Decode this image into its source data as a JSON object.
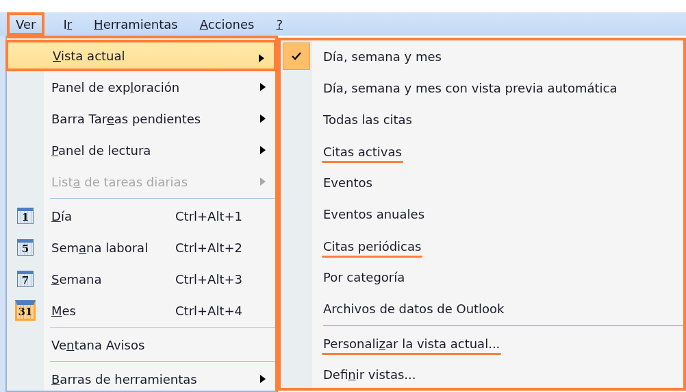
{
  "menubar": [
    {
      "parts": [
        {
          "text": "Ver",
          "underlined": false
        }
      ],
      "highlighted": true
    },
    {
      "parts": [
        {
          "text": "I",
          "underlined": false
        },
        {
          "text": "r",
          "underlined": true
        }
      ],
      "highlighted": false
    },
    {
      "parts": [
        {
          "text": "H",
          "underlined": true
        },
        {
          "text": "erramientas",
          "underlined": false
        }
      ],
      "highlighted": false
    },
    {
      "parts": [
        {
          "text": "A",
          "underlined": true
        },
        {
          "text": "cciones",
          "underlined": false
        }
      ],
      "highlighted": false
    },
    {
      "parts": [
        {
          "text": "?",
          "underlined": true
        }
      ],
      "highlighted": false
    }
  ],
  "menu": {
    "highlighted": true,
    "items": [
      {
        "kind": "item",
        "parts": [
          {
            "text": "V",
            "underlined": true
          },
          {
            "text": "ista actual",
            "underlined": false
          }
        ],
        "submenu": true,
        "selected": true,
        "highlighted": true,
        "disabled": false
      },
      {
        "kind": "item",
        "parts": [
          {
            "text": "Panel de exp",
            "underlined": false
          },
          {
            "text": "l",
            "underlined": true
          },
          {
            "text": "oración",
            "underlined": false
          }
        ],
        "submenu": true,
        "selected": false,
        "highlighted": false,
        "disabled": false
      },
      {
        "kind": "item",
        "parts": [
          {
            "text": "Barra Tar",
            "underlined": false
          },
          {
            "text": "e",
            "underlined": true
          },
          {
            "text": "as pendientes",
            "underlined": false
          }
        ],
        "submenu": true,
        "selected": false,
        "highlighted": false,
        "disabled": false
      },
      {
        "kind": "item",
        "parts": [
          {
            "text": "P",
            "underlined": true
          },
          {
            "text": "anel de lectura",
            "underlined": false
          }
        ],
        "submenu": true,
        "selected": false,
        "highlighted": false,
        "disabled": false
      },
      {
        "kind": "item",
        "parts": [
          {
            "text": "List",
            "underlined": false
          },
          {
            "text": "a",
            "underlined": true
          },
          {
            "text": " de tareas diarias",
            "underlined": false
          }
        ],
        "submenu": true,
        "selected": false,
        "highlighted": false,
        "disabled": true
      },
      {
        "kind": "separator"
      },
      {
        "kind": "item",
        "parts": [
          {
            "text": "D",
            "underlined": true
          },
          {
            "text": "ía",
            "underlined": false
          }
        ],
        "icon_text": "1",
        "icon_highlighted": false,
        "shortcut": "Ctrl+Alt+1",
        "submenu": false,
        "selected": false,
        "highlighted": false,
        "disabled": false
      },
      {
        "kind": "item",
        "parts": [
          {
            "text": "Sem",
            "underlined": false
          },
          {
            "text": "a",
            "underlined": true
          },
          {
            "text": "na laboral",
            "underlined": false
          }
        ],
        "icon_text": "5",
        "icon_highlighted": false,
        "shortcut": "Ctrl+Alt+2",
        "submenu": false,
        "selected": false,
        "highlighted": false,
        "disabled": false
      },
      {
        "kind": "item",
        "parts": [
          {
            "text": "S",
            "underlined": true
          },
          {
            "text": "emana",
            "underlined": false
          }
        ],
        "icon_text": "7",
        "icon_highlighted": false,
        "shortcut": "Ctrl+Alt+3",
        "submenu": false,
        "selected": false,
        "highlighted": false,
        "disabled": false
      },
      {
        "kind": "item",
        "parts": [
          {
            "text": "M",
            "underlined": true
          },
          {
            "text": "es",
            "underlined": false
          }
        ],
        "icon_text": "31",
        "icon_highlighted": true,
        "shortcut": "Ctrl+Alt+4",
        "submenu": false,
        "selected": false,
        "highlighted": false,
        "disabled": false
      },
      {
        "kind": "separator"
      },
      {
        "kind": "item",
        "parts": [
          {
            "text": "Ve",
            "underlined": false
          },
          {
            "text": "n",
            "underlined": true
          },
          {
            "text": "tana Avisos",
            "underlined": false
          }
        ],
        "submenu": false,
        "selected": false,
        "highlighted": false,
        "disabled": false
      },
      {
        "kind": "separator"
      },
      {
        "kind": "item",
        "parts": [
          {
            "text": "B",
            "underlined": true
          },
          {
            "text": "arras de herramientas",
            "underlined": false
          }
        ],
        "submenu": true,
        "selected": false,
        "highlighted": false,
        "disabled": false
      }
    ]
  },
  "submenu": {
    "highlighted": true,
    "items": [
      {
        "kind": "item",
        "parts": [
          {
            "text": "Día, semana y mes",
            "underlined": false
          }
        ],
        "checked": true,
        "annotated": false
      },
      {
        "kind": "item",
        "parts": [
          {
            "text": "Día, semana y mes con vista previa automática",
            "underlined": false
          }
        ],
        "checked": false,
        "annotated": false
      },
      {
        "kind": "item",
        "parts": [
          {
            "text": "Todas las citas",
            "underlined": false
          }
        ],
        "checked": false,
        "annotated": false
      },
      {
        "kind": "item",
        "parts": [
          {
            "text": "Citas activas",
            "underlined": false
          }
        ],
        "checked": false,
        "annotated": true
      },
      {
        "kind": "item",
        "parts": [
          {
            "text": "Eventos",
            "underlined": false
          }
        ],
        "checked": false,
        "annotated": false
      },
      {
        "kind": "item",
        "parts": [
          {
            "text": "Eventos anuales",
            "underlined": false
          }
        ],
        "checked": false,
        "annotated": false
      },
      {
        "kind": "item",
        "parts": [
          {
            "text": "Citas periódicas",
            "underlined": false
          }
        ],
        "checked": false,
        "annotated": true
      },
      {
        "kind": "item",
        "parts": [
          {
            "text": "Por categoría",
            "underlined": false
          }
        ],
        "checked": false,
        "annotated": false
      },
      {
        "kind": "item",
        "parts": [
          {
            "text": "Archivos de datos de Outlook",
            "underlined": false
          }
        ],
        "checked": false,
        "annotated": false
      },
      {
        "kind": "separator"
      },
      {
        "kind": "item",
        "parts": [
          {
            "text": "Personali",
            "underlined": false
          },
          {
            "text": "z",
            "underlined": true
          },
          {
            "text": "ar la vista actual...",
            "underlined": false
          }
        ],
        "checked": false,
        "annotated": true
      },
      {
        "kind": "item",
        "parts": [
          {
            "text": "Defi",
            "underlined": false
          },
          {
            "text": "n",
            "underlined": true
          },
          {
            "text": "ir vistas...",
            "underlined": false
          }
        ],
        "checked": false,
        "annotated": false
      }
    ]
  }
}
